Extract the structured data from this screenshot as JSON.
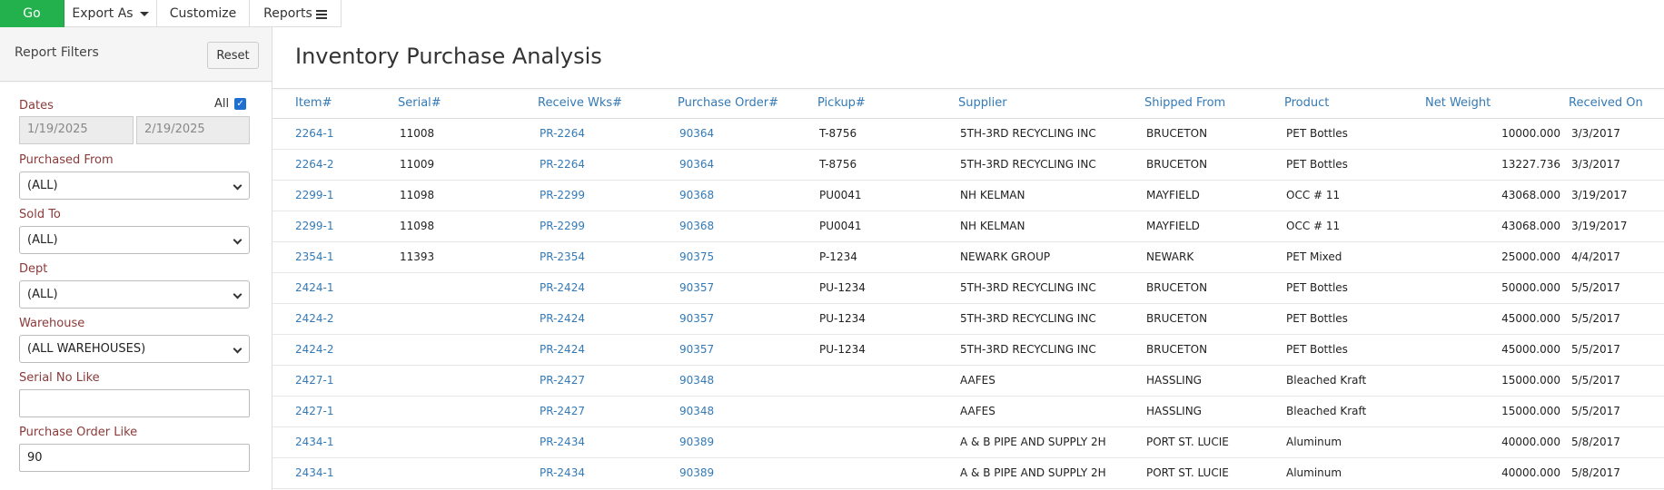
{
  "toolbar": {
    "go": "Go",
    "export_as": "Export As",
    "customize": "Customize",
    "reports": "Reports"
  },
  "filters": {
    "title": "Report Filters",
    "reset": "Reset",
    "dates_label": "Dates",
    "all_label": "All",
    "all_checked": true,
    "date_from": "1/19/2025",
    "date_to": "2/19/2025",
    "purchased_from_label": "Purchased From",
    "purchased_from_value": "(ALL)",
    "sold_to_label": "Sold To",
    "sold_to_value": "(ALL)",
    "dept_label": "Dept",
    "dept_value": "(ALL)",
    "warehouse_label": "Warehouse",
    "warehouse_value": "(ALL WAREHOUSES)",
    "serial_label": "Serial No Like",
    "serial_value": "",
    "po_label": "Purchase Order Like",
    "po_value": "90"
  },
  "report": {
    "title": "Inventory Purchase Analysis",
    "columns": [
      "Item#",
      "Serial#",
      "Receive Wks#",
      "Purchase Order#",
      "Pickup#",
      "Supplier",
      "Shipped From",
      "Product",
      "Net Weight",
      "Received On"
    ],
    "rows": [
      [
        "2264-1",
        "11008",
        "PR-2264",
        "90364",
        "T-8756",
        "5TH-3RD RECYCLING INC",
        "BRUCETON",
        "PET Bottles",
        "10000.000",
        "3/3/2017"
      ],
      [
        "2264-2",
        "11009",
        "PR-2264",
        "90364",
        "T-8756",
        "5TH-3RD RECYCLING INC",
        "BRUCETON",
        "PET Bottles",
        "13227.736",
        "3/3/2017"
      ],
      [
        "2299-1",
        "11098",
        "PR-2299",
        "90368",
        "PU0041",
        "NH KELMAN",
        "MAYFIELD",
        "OCC # 11",
        "43068.000",
        "3/19/2017"
      ],
      [
        "2299-1",
        "11098",
        "PR-2299",
        "90368",
        "PU0041",
        "NH KELMAN",
        "MAYFIELD",
        "OCC # 11",
        "43068.000",
        "3/19/2017"
      ],
      [
        "2354-1",
        "11393",
        "PR-2354",
        "90375",
        "P-1234",
        "NEWARK GROUP",
        "NEWARK",
        "PET Mixed",
        "25000.000",
        "4/4/2017"
      ],
      [
        "2424-1",
        "",
        "PR-2424",
        "90357",
        "PU-1234",
        "5TH-3RD RECYCLING INC",
        "BRUCETON",
        "PET Bottles",
        "50000.000",
        "5/5/2017"
      ],
      [
        "2424-2",
        "",
        "PR-2424",
        "90357",
        "PU-1234",
        "5TH-3RD RECYCLING INC",
        "BRUCETON",
        "PET Bottles",
        "45000.000",
        "5/5/2017"
      ],
      [
        "2424-2",
        "",
        "PR-2424",
        "90357",
        "PU-1234",
        "5TH-3RD RECYCLING INC",
        "BRUCETON",
        "PET Bottles",
        "45000.000",
        "5/5/2017"
      ],
      [
        "2427-1",
        "",
        "PR-2427",
        "90348",
        "",
        "AAFES",
        "HASSLING",
        "Bleached Kraft",
        "15000.000",
        "5/5/2017"
      ],
      [
        "2427-1",
        "",
        "PR-2427",
        "90348",
        "",
        "AAFES",
        "HASSLING",
        "Bleached Kraft",
        "15000.000",
        "5/5/2017"
      ],
      [
        "2434-1",
        "",
        "PR-2434",
        "90389",
        "",
        "A & B PIPE AND SUPPLY 2H",
        "PORT ST. LUCIE",
        "Aluminum",
        "40000.000",
        "5/8/2017"
      ],
      [
        "2434-1",
        "",
        "PR-2434",
        "90389",
        "",
        "A & B PIPE AND SUPPLY 2H",
        "PORT ST. LUCIE",
        "Aluminum",
        "40000.000",
        "5/8/2017"
      ]
    ]
  }
}
